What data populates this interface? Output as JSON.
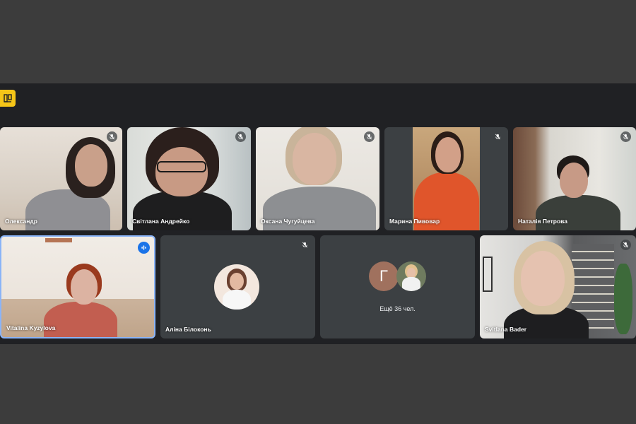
{
  "app": {
    "badge_icon": "meet-badge-icon",
    "badge_color": "#f5c518"
  },
  "participants": [
    {
      "name": "Олександр",
      "muted": true
    },
    {
      "name": "Світлана Андрейко",
      "muted": true
    },
    {
      "name": "Оксана Чугуйцева",
      "muted": true
    },
    {
      "name": "Марина Пивовар",
      "muted": true
    },
    {
      "name": "Наталія Петрова",
      "muted": true
    },
    {
      "name": "Vitalina Kyzylova",
      "muted": false,
      "speaking": true
    },
    {
      "name": "Аліна Білоконь",
      "muted": true
    },
    {
      "name": "Svitlana Bader",
      "muted": true
    }
  ],
  "overflow_tile": {
    "letter": "Г",
    "text": "Ещё 36 чел."
  },
  "colors": {
    "meeting_bg": "#202124",
    "tile_bg": "#3c4043",
    "speaking_accent": "#1a73e8",
    "active_border": "#8ab4f8"
  }
}
